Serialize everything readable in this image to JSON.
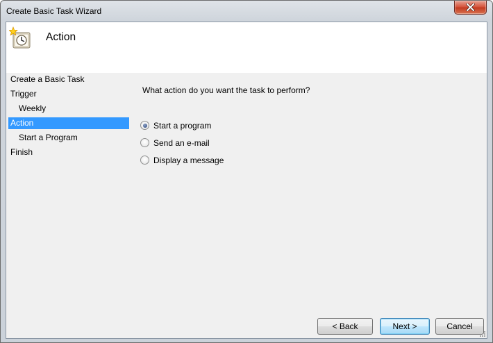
{
  "window": {
    "title": "Create Basic Task Wizard"
  },
  "header": {
    "title": "Action",
    "icon": "scheduled-task-clock-icon"
  },
  "nav": {
    "items": [
      {
        "label": "Create a Basic Task"
      },
      {
        "label": "Trigger"
      },
      {
        "label": "Weekly"
      },
      {
        "label": "Action",
        "selected": true
      },
      {
        "label": "Start a Program"
      },
      {
        "label": "Finish"
      }
    ]
  },
  "main": {
    "question": "What action do you want the task to perform?",
    "options": [
      {
        "label": "Start a program",
        "selected": true
      },
      {
        "label": "Send an e-mail",
        "selected": false
      },
      {
        "label": "Display a message",
        "selected": false
      }
    ]
  },
  "buttons": {
    "back": "< Back",
    "next": "Next >",
    "cancel": "Cancel"
  },
  "colors": {
    "selection": "#3399ff",
    "close_button": "#c33a20",
    "default_button_border": "#3c7fb1"
  }
}
